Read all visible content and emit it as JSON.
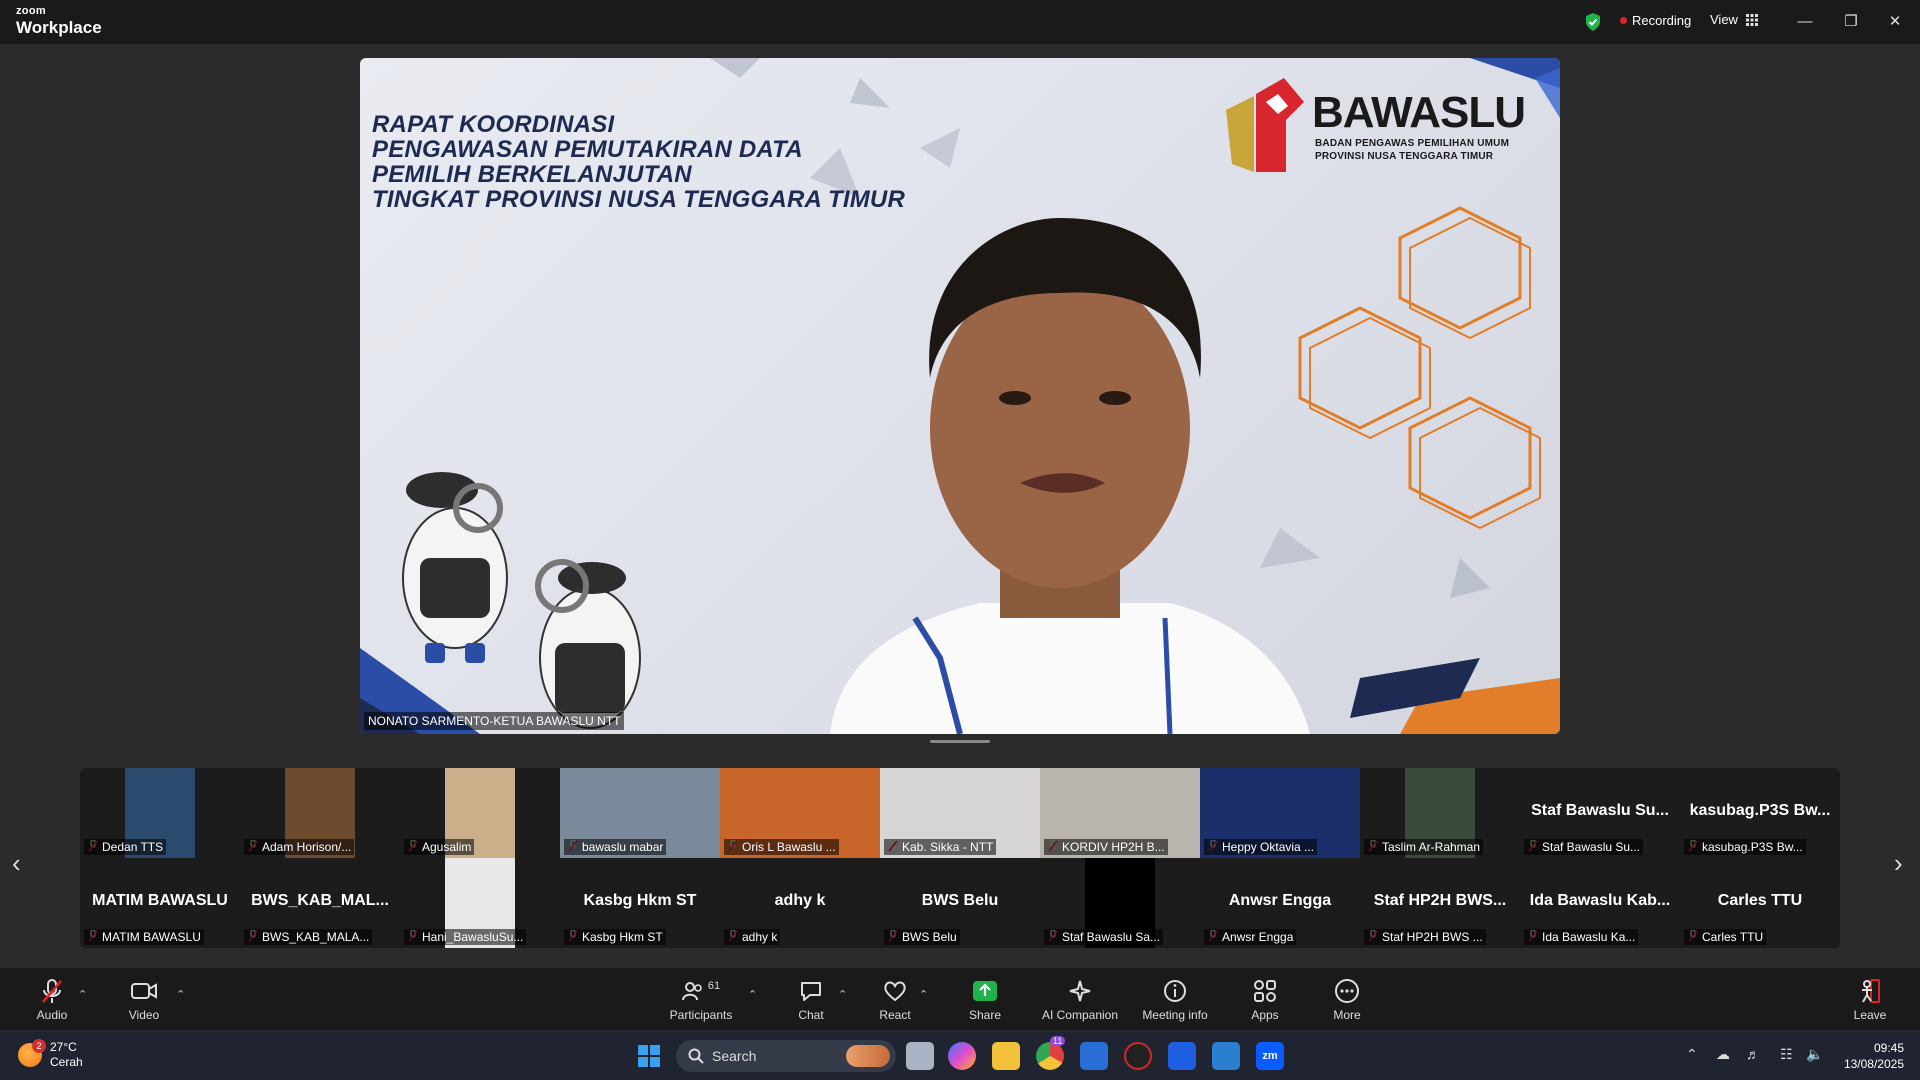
{
  "app": {
    "brand_small": "zoom",
    "brand_big": "Workplace"
  },
  "titlebar": {
    "recording": "Recording",
    "view": "View"
  },
  "stage": {
    "title_lines": [
      "RAPAT KOORDINASI",
      "PENGAWASAN PEMUTAKIRAN DATA",
      "PEMILIH BERKELANJUTAN",
      "TINGKAT PROVINSI NUSA TENGGARA TIMUR"
    ],
    "logo_word": "BAWASLU",
    "logo_sub1": "BADAN PENGAWAS PEMILIHAN UMUM",
    "logo_sub2": "PROVINSI NUSA TENGGARA TIMUR",
    "speaker": "NONATO SARMENTO-KETUA BAWASLU NTT"
  },
  "gallery": {
    "row1": [
      {
        "label": "Dedan TTS",
        "name": "",
        "video": true,
        "bg": "#2c4a6e"
      },
      {
        "label": "Adam Horison/...",
        "name": "",
        "video": true,
        "bg": "#6b4a2e"
      },
      {
        "label": "Agusalim",
        "name": "",
        "video": true,
        "bg": "#c9b08a"
      },
      {
        "label": "bawaslu mabar",
        "name": "",
        "video": true,
        "bg": "#7b8a9a"
      },
      {
        "label": "Oris L Bawaslu ...",
        "name": "",
        "video": true,
        "bg": "#c7652a"
      },
      {
        "label": "Kab. Sikka - NTT",
        "name": "",
        "video": true,
        "bg": "#d8d6d4"
      },
      {
        "label": "KORDIV HP2H B...",
        "name": "",
        "video": true,
        "bg": "#b9b4ae"
      },
      {
        "label": "Heppy Oktavia ...",
        "name": "",
        "video": true,
        "bg": "#1b2f6a"
      },
      {
        "label": "Taslim  Ar-Rahman",
        "name": "",
        "video": true,
        "bg": "#3a4a3a"
      },
      {
        "label": "Staf Bawaslu Su...",
        "name": "Staf Bawaslu Su...",
        "video": false,
        "bg": "#1c1c1c"
      },
      {
        "label": "kasubag.P3S Bw...",
        "name": "kasubag.P3S  Bw...",
        "video": false,
        "bg": "#1c1c1c"
      }
    ],
    "row2": [
      {
        "label": "MATIM BAWASLU",
        "name": "MATIM BAWASLU",
        "video": false,
        "bg": "#1c1c1c"
      },
      {
        "label": "BWS_KAB_MALA...",
        "name": "BWS_KAB_MAL...",
        "video": false,
        "bg": "#1c1c1c"
      },
      {
        "label": "Hani_BawasluSu...",
        "name": "",
        "video": true,
        "bg": "#e8e8e8"
      },
      {
        "label": "Kasbg Hkm ST",
        "name": "Kasbg Hkm ST",
        "video": false,
        "bg": "#1c1c1c"
      },
      {
        "label": "adhy k",
        "name": "adhy k",
        "video": false,
        "bg": "#1c1c1c"
      },
      {
        "label": "BWS Belu",
        "name": "BWS Belu",
        "video": false,
        "bg": "#1c1c1c"
      },
      {
        "label": "Staf Bawaslu Sa...",
        "name": "",
        "video": true,
        "bg": "#000000"
      },
      {
        "label": "Anwsr Engga",
        "name": "Anwsr Engga",
        "video": false,
        "bg": "#1c1c1c"
      },
      {
        "label": "Staf HP2H BWS ...",
        "name": "Staf HP2H BWS...",
        "video": false,
        "bg": "#1c1c1c"
      },
      {
        "label": "Ida Bawaslu Ka...",
        "name": "Ida Bawaslu Kab...",
        "video": false,
        "bg": "#1c1c1c"
      },
      {
        "label": "Carles TTU",
        "name": "Carles TTU",
        "video": false,
        "bg": "#1c1c1c"
      }
    ]
  },
  "toolbar": {
    "audio": "Audio",
    "video": "Video",
    "participants": "Participants",
    "participants_count": "61",
    "chat": "Chat",
    "react": "React",
    "share": "Share",
    "ai": "AI Companion",
    "info": "Meeting info",
    "apps": "Apps",
    "more": "More",
    "leave": "Leave"
  },
  "taskbar": {
    "temp": "27°C",
    "weather": "Cerah",
    "weather_badge": "2",
    "search": "Search",
    "time": "09:45",
    "date": "13/08/2025",
    "chrome_badge": "11"
  },
  "colors": {
    "accent": "#0b5cff",
    "share": "#1fb34a",
    "recording": "#e02424",
    "title_navy": "#1e2a52",
    "logo_red": "#d7262e"
  }
}
